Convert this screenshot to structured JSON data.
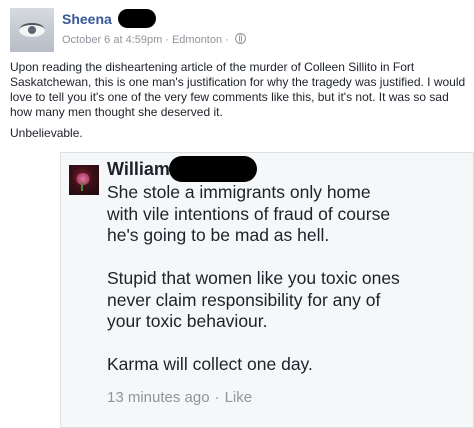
{
  "post": {
    "author": "Sheena",
    "timestamp": "October 6 at 4:59pm",
    "location": "Edmonton",
    "separator": "·",
    "privacy_icon": "globe-icon",
    "body": [
      "Upon reading the disheartening article of the murder of Colleen Sillito in Fort Saskatchewan, this is one man's justification for why the tragedy was justified. I would love to tell you it's one of the very few comments like this, but it's not. It was so sad how many men thought she deserved it.",
      "Unbelievable."
    ]
  },
  "comment": {
    "author": "William",
    "paragraphs": [
      "She stole a immigrants only home\nwith vile intentions of fraud of course\nhe's going to be mad as hell.",
      "Stupid that women like you toxic ones\nnever claim responsibility for any of\nyour toxic behaviour.",
      "Karma will collect one day."
    ],
    "time_ago": "13 minutes ago",
    "separator": "·",
    "like_label": "Like"
  },
  "colors": {
    "link_blue": "#365899",
    "meta_gray": "#90949c",
    "comment_bg": "#f6f7f9",
    "redaction": "#000000"
  }
}
